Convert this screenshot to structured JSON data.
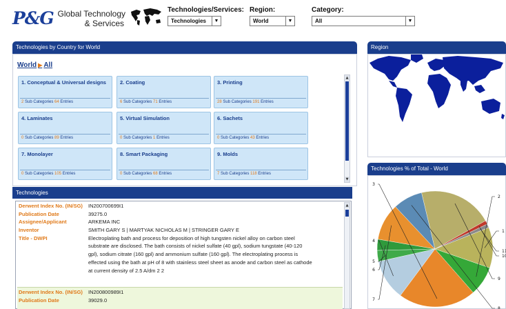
{
  "header": {
    "logo": "P&G",
    "brand_line1": "Global Technology",
    "brand_line2": "& Services",
    "filters": [
      {
        "label": "Technologies/Services:",
        "value": "Technologies"
      },
      {
        "label": "Region:",
        "value": "World"
      },
      {
        "label": "Category:",
        "value": "All"
      }
    ]
  },
  "tech_panel": {
    "title": "Technologies by Country for World",
    "breadcrumb": [
      "World",
      "All"
    ],
    "sub_label": "Sub Categories",
    "entries_label": "Entries",
    "categories": [
      {
        "title": "1. Conceptual & Universal designs",
        "sub": "2",
        "entries": "64"
      },
      {
        "title": "2. Coating",
        "sub": "6",
        "entries": "71"
      },
      {
        "title": "3. Printing",
        "sub": "28",
        "entries": "191"
      },
      {
        "title": "4. Laminates",
        "sub": "0",
        "entries": "89"
      },
      {
        "title": "5. Virtual Simulation",
        "sub": "0",
        "entries": "1"
      },
      {
        "title": "6. Sachets",
        "sub": "0",
        "entries": "43"
      },
      {
        "title": "7. Monolayer",
        "sub": "0",
        "entries": "105"
      },
      {
        "title": "8. Smart Packaging",
        "sub": "0",
        "entries": "68"
      },
      {
        "title": "9. Molds",
        "sub": "7",
        "entries": "118"
      }
    ]
  },
  "technologies": {
    "title": "Technologies",
    "records": [
      {
        "fields": [
          {
            "key": "Derwent Index No. (IN/SG)",
            "value": "IN200700699I1"
          },
          {
            "key": "Publication Date",
            "value": "39275.0"
          },
          {
            "key": "Assignee/Applicant",
            "value": "ARKEMA INC"
          },
          {
            "key": "Inventor",
            "value": "SMITH GARY S | MARTYAK NICHOLAS M | STRINGER GARY E"
          }
        ],
        "title_key": "Title - DWPI",
        "title_lines": [
          "Electroplating bath and process for deposition of high tungsten nickel alloy on carbon steel",
          "substrate are disclosed. The bath consists of nickel sulfate (40 gpl), sodium tungstate (40-120",
          "gpl), sodium citrate (160 gpl) and ammonium sulfate (160 gpl). The electroplating process is",
          "effected using the bath at pH of 8 with stainless steel sheet as anode and carbon steel as cathode",
          "at current density of 2.5 A/dm 2 2"
        ]
      },
      {
        "fields": [
          {
            "key": "Derwent Index No. (IN/SG)",
            "value": "IN200800989I1"
          },
          {
            "key": "Publication Date",
            "value": "39029.0"
          }
        ]
      }
    ]
  },
  "region_panel": {
    "title": "Region"
  },
  "pie_panel": {
    "title": "Technologies % of Total - World"
  },
  "chart_data": {
    "type": "pie",
    "title": "Technologies % of Total - World",
    "labels": [
      "1",
      "2",
      "3",
      "4",
      "5",
      "6",
      "7",
      "8",
      "9",
      "10",
      "11"
    ],
    "values": [
      11,
      8,
      21,
      11,
      3,
      3,
      10,
      8,
      20,
      1,
      1
    ],
    "colors": [
      "#b9b35c",
      "#35a838",
      "#e8872a",
      "#b4cde0",
      "#3faa4a",
      "#2f9a3c",
      "#e8902e",
      "#5b8bb5",
      "#b7ae6a",
      "#c0392b",
      "#8a8a8a"
    ]
  }
}
